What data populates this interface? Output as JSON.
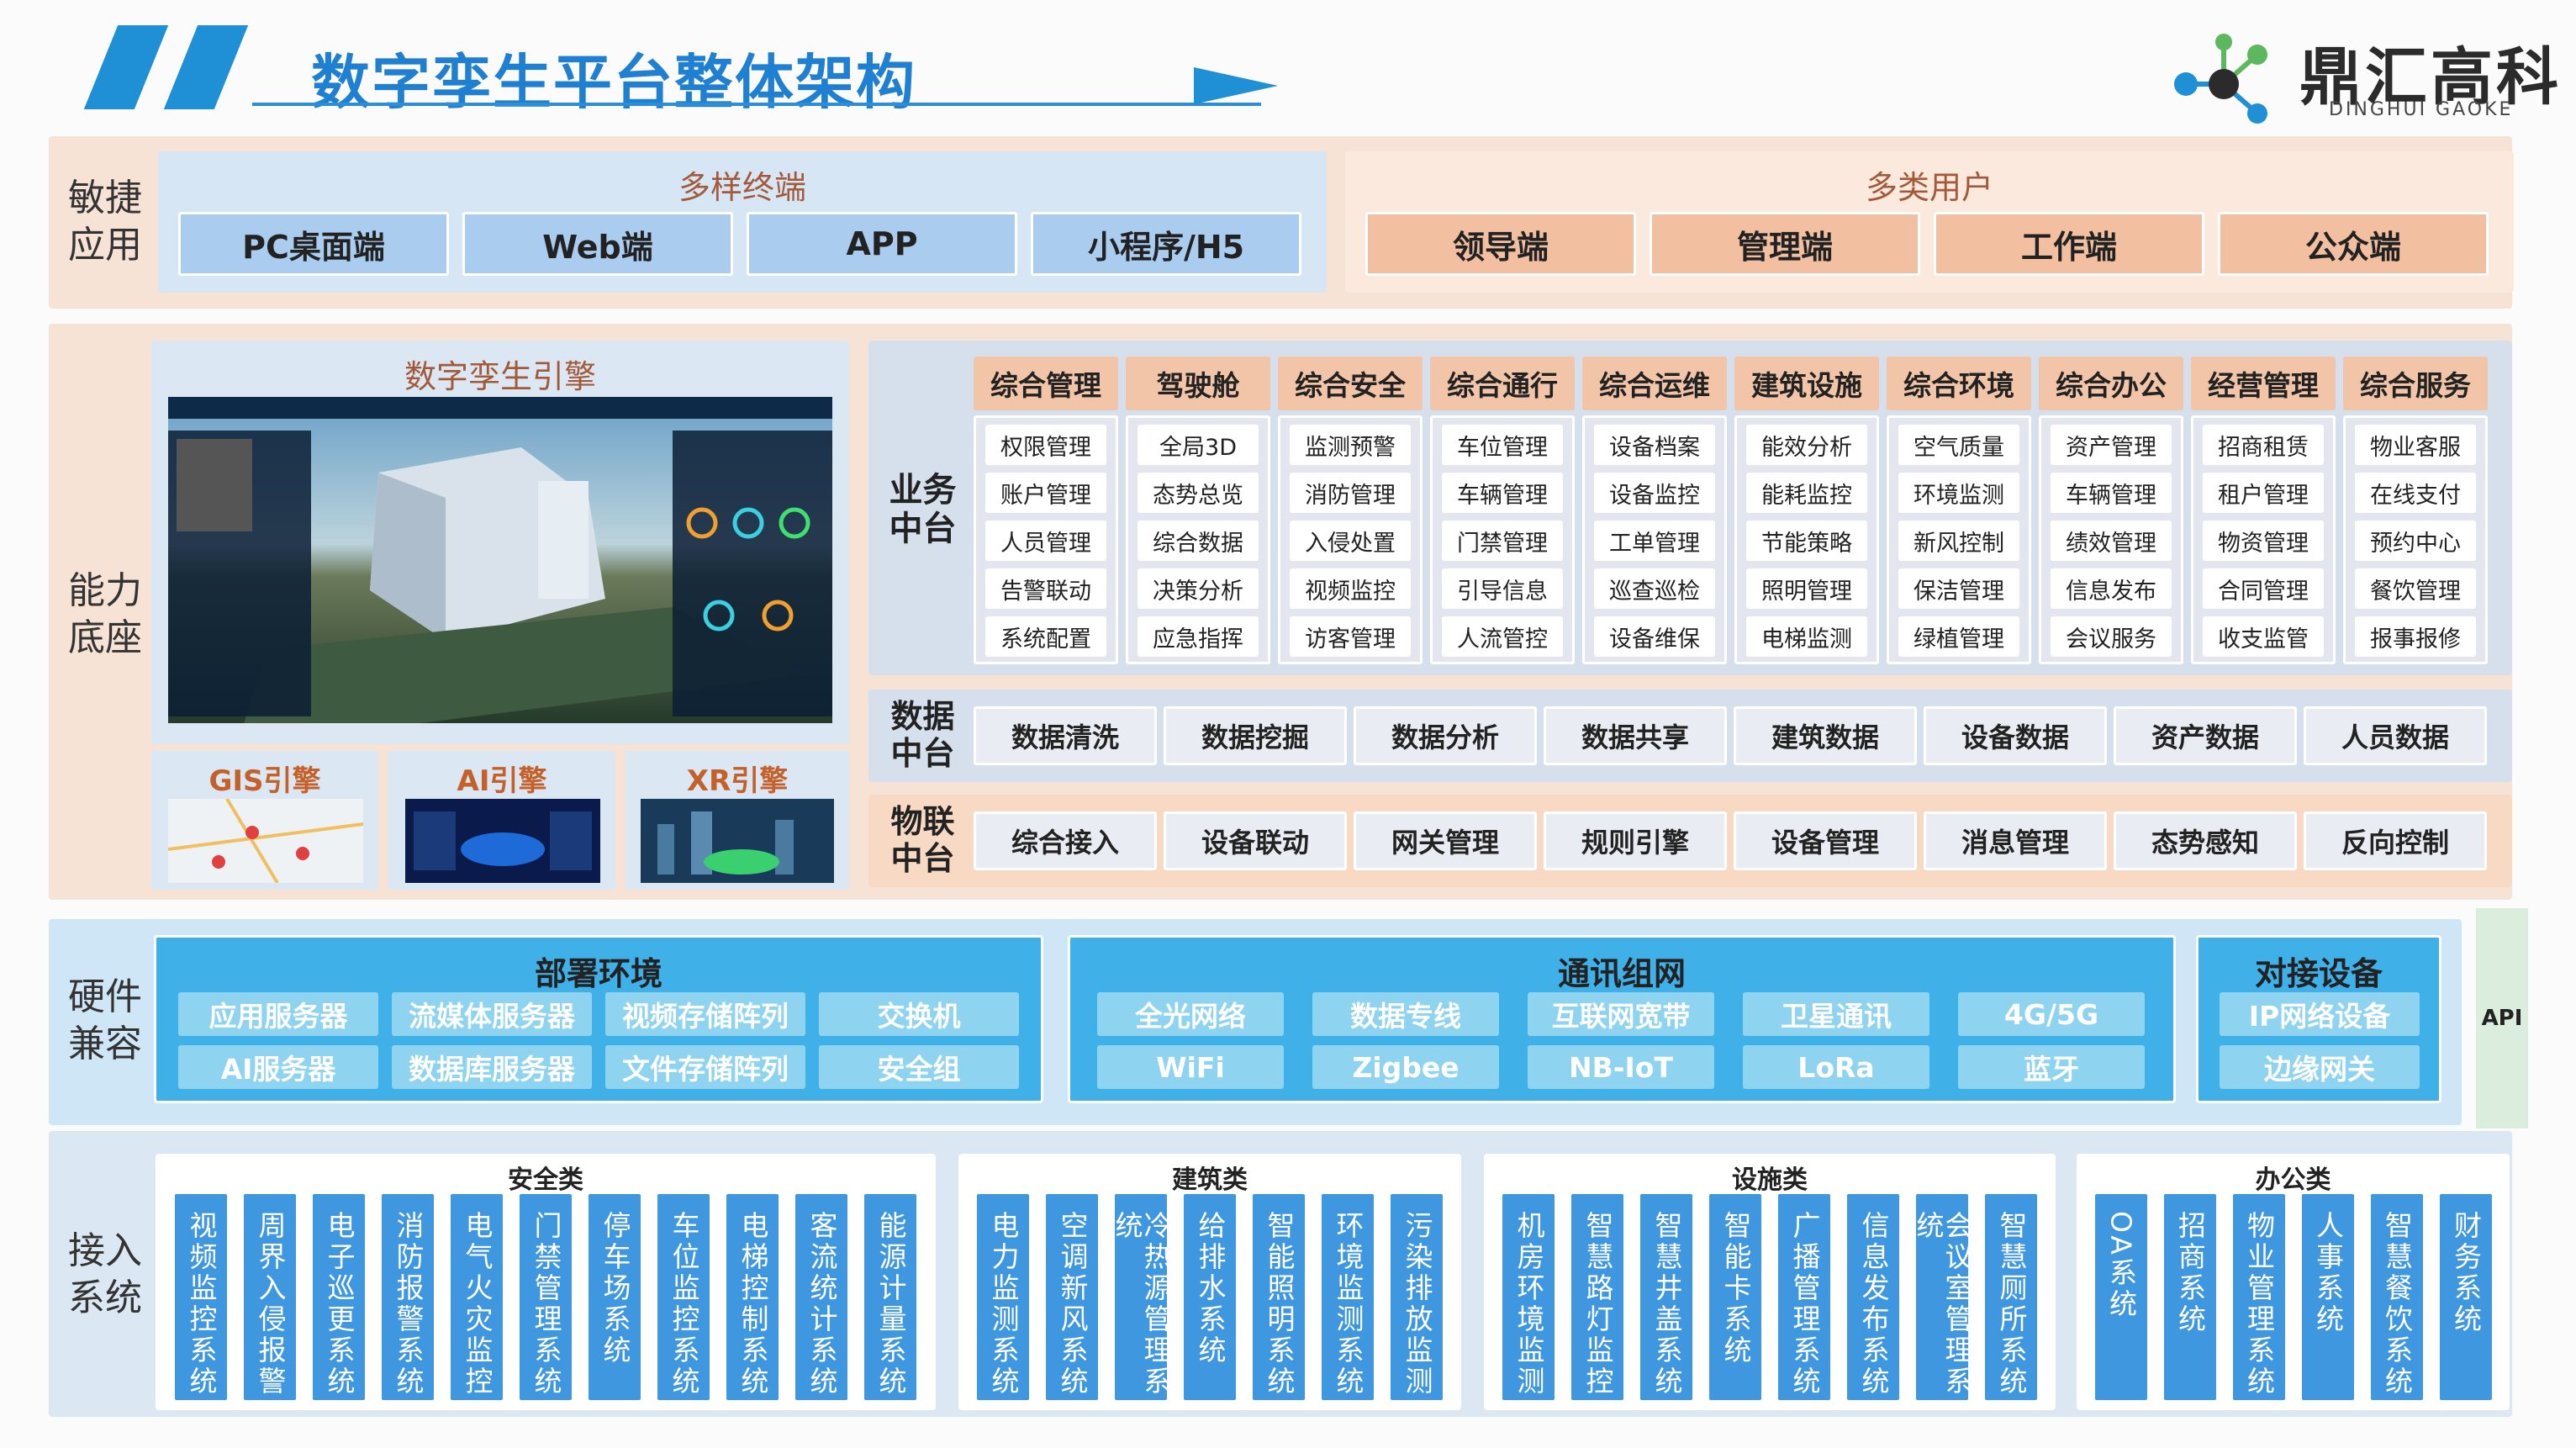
{
  "header": {
    "title": "数字孪生平台整体架构",
    "logo_name": "鼎汇高科",
    "logo_sub": "DINGHUI GAOKE",
    "logo_icon": "molecule-icon"
  },
  "agile": {
    "label": "敏捷应用",
    "terminals_title": "多样终端",
    "terminals": [
      "PC桌面端",
      "Web端",
      "APP",
      "小程序/H5"
    ],
    "users_title": "多类用户",
    "users": [
      "领导端",
      "管理端",
      "工作端",
      "公众端"
    ]
  },
  "capability": {
    "label": "能力底座",
    "engine_title": "数字孪生引擎",
    "sub_engines": [
      "GIS引擎",
      "AI引擎",
      "XR引擎"
    ],
    "business_label": "业务中台",
    "business": [
      {
        "name": "综合管理",
        "items": [
          "权限管理",
          "账户管理",
          "人员管理",
          "告警联动",
          "系统配置"
        ]
      },
      {
        "name": "驾驶舱",
        "items": [
          "全局3D",
          "态势总览",
          "综合数据",
          "决策分析",
          "应急指挥"
        ]
      },
      {
        "name": "综合安全",
        "items": [
          "监测预警",
          "消防管理",
          "入侵处置",
          "视频监控",
          "访客管理"
        ]
      },
      {
        "name": "综合通行",
        "items": [
          "车位管理",
          "车辆管理",
          "门禁管理",
          "引导信息",
          "人流管控"
        ]
      },
      {
        "name": "综合运维",
        "items": [
          "设备档案",
          "设备监控",
          "工单管理",
          "巡查巡检",
          "设备维保"
        ]
      },
      {
        "name": "建筑设施",
        "items": [
          "能效分析",
          "能耗监控",
          "节能策略",
          "照明管理",
          "电梯监测"
        ]
      },
      {
        "name": "综合环境",
        "items": [
          "空气质量",
          "环境监测",
          "新风控制",
          "保洁管理",
          "绿植管理"
        ]
      },
      {
        "name": "综合办公",
        "items": [
          "资产管理",
          "车辆管理",
          "绩效管理",
          "信息发布",
          "会议服务"
        ]
      },
      {
        "name": "经营管理",
        "items": [
          "招商租赁",
          "租户管理",
          "物资管理",
          "合同管理",
          "收支监管"
        ]
      },
      {
        "name": "综合服务",
        "items": [
          "物业客服",
          "在线支付",
          "预约中心",
          "餐饮管理",
          "报事报修"
        ]
      }
    ],
    "data_label": "数据中台",
    "data": [
      "数据清洗",
      "数据挖掘",
      "数据分析",
      "数据共享",
      "建筑数据",
      "设备数据",
      "资产数据",
      "人员数据"
    ],
    "iot_label": "物联中台",
    "iot": [
      "综合接入",
      "设备联动",
      "网关管理",
      "规则引擎",
      "设备管理",
      "消息管理",
      "态势感知",
      "反向控制"
    ]
  },
  "hardware": {
    "label": "硬件兼容",
    "deploy_title": "部署环境",
    "deploy": [
      "应用服务器",
      "流媒体服务器",
      "视频存储阵列",
      "交换机",
      "AI服务器",
      "数据库服务器",
      "文件存储阵列",
      "安全组"
    ],
    "network_title": "通讯组网",
    "network": [
      "全光网络",
      "数据专线",
      "互联网宽带",
      "卫星通讯",
      "4G/5G",
      "WiFi",
      "Zigbee",
      "NB-IoT",
      "LoRa",
      "蓝牙"
    ],
    "device_title": "对接设备",
    "device": [
      "IP网络设备",
      "边缘网关"
    ]
  },
  "api_label": "API",
  "access": {
    "label": "接入系统",
    "groups": [
      {
        "name": "安全类",
        "items": [
          "视频监控系统",
          "周界入侵报警",
          "电子巡更系统",
          "消防报警系统",
          "电气火灾监控",
          "门禁管理系统",
          "停车场系统",
          "车位监控系统",
          "电梯控制系统",
          "客流统计系统",
          "能源计量系统"
        ]
      },
      {
        "name": "建筑类",
        "items": [
          "电力监测系统",
          "空调新风系统",
          "冷热源管理系统",
          "给排水系统",
          "智能照明系统",
          "环境监测系统",
          "污染排放监测"
        ]
      },
      {
        "name": "设施类",
        "items": [
          "机房环境监测",
          "智慧路灯监控",
          "智慧井盖系统",
          "智能卡系统",
          "广播管理系统",
          "信息发布系统",
          "会议室管理系统",
          "智慧厕所系统"
        ]
      },
      {
        "name": "办公类",
        "items": [
          "OA系统",
          "招商系统",
          "物业管理系统",
          "人事系统",
          "智慧餐饮系统",
          "财务系统"
        ]
      }
    ]
  },
  "colors": {
    "accent": "#1f8fd6",
    "peach_band": "#f7e3d6",
    "blue_band": "#dbe7f3",
    "hw_band": "#cfe6f6",
    "hw_panel": "#3fb0e8"
  }
}
